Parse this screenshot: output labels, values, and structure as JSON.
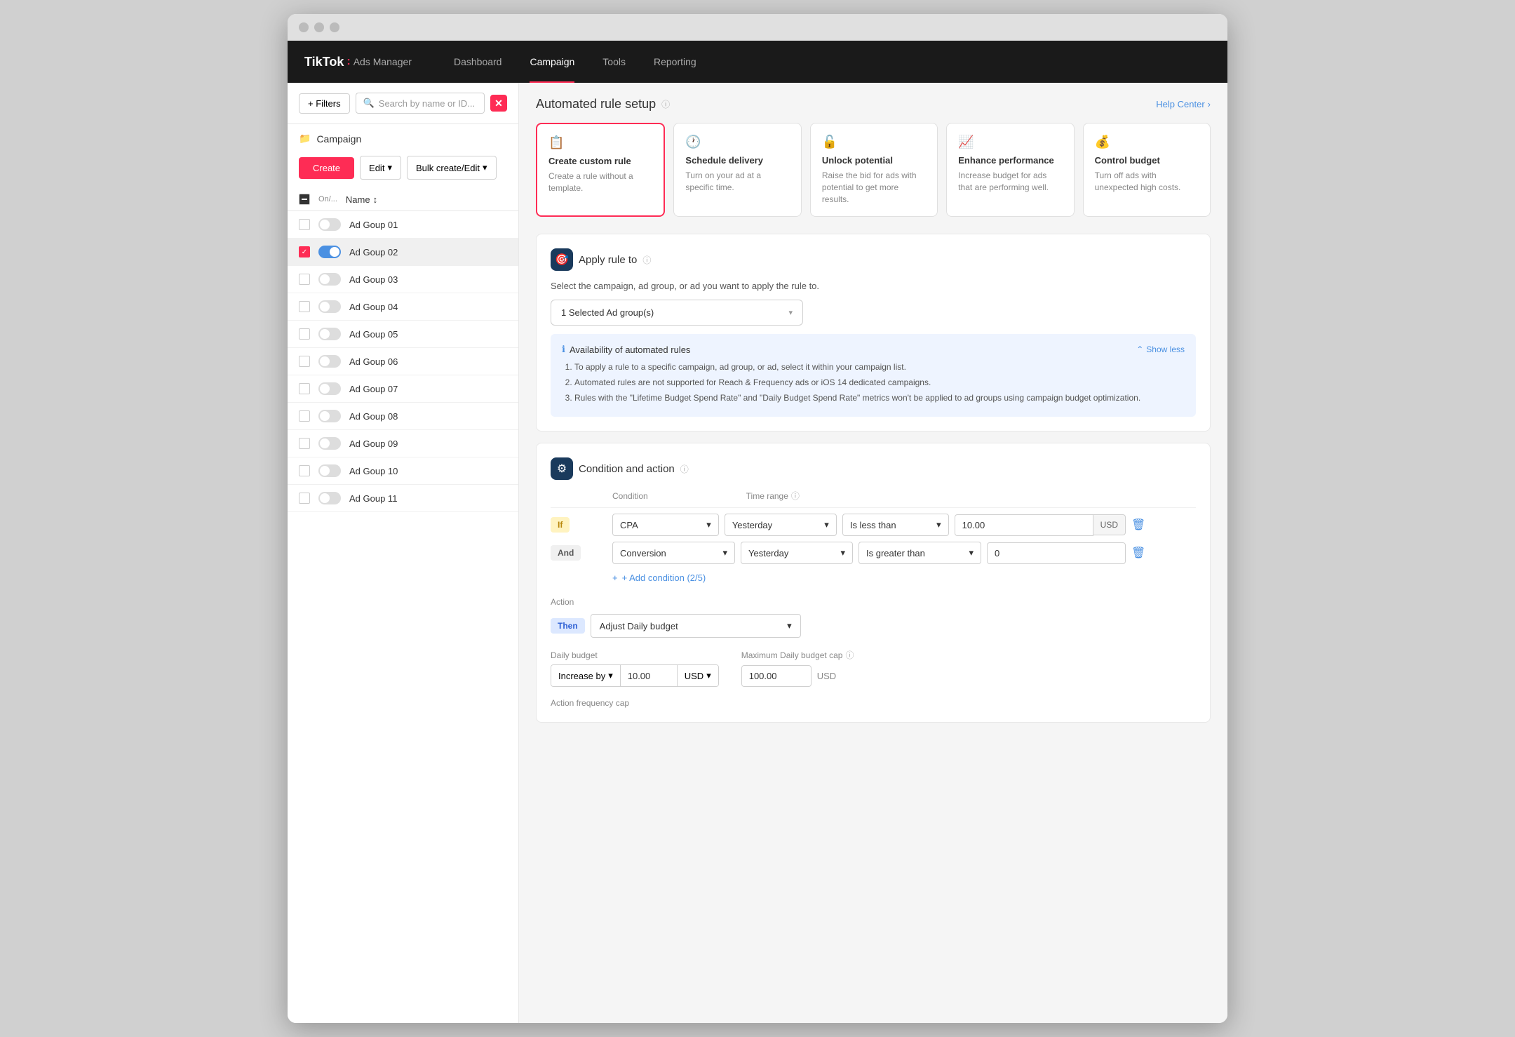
{
  "browser": {
    "dots": [
      "dot1",
      "dot2",
      "dot3"
    ]
  },
  "nav": {
    "brand": "TikTok",
    "colon": ":",
    "sub": "Ads Manager",
    "items": [
      {
        "label": "Dashboard",
        "active": false
      },
      {
        "label": "Campaign",
        "active": true
      },
      {
        "label": "Tools",
        "active": false
      },
      {
        "label": "Reporting",
        "active": false
      }
    ]
  },
  "sidebar": {
    "filters_label": "+ Filters",
    "search_placeholder": "Search by name or ID...",
    "close_x": "✕",
    "section_icon": "📁",
    "section_title": "Campaign",
    "create_label": "Create",
    "edit_label": "Edit",
    "bulk_label": "Bulk create/Edit",
    "table_header_name": "Name",
    "rows": [
      {
        "name": "Ad Goup 01",
        "on": false,
        "checked": false,
        "active": false
      },
      {
        "name": "Ad Goup 02",
        "on": true,
        "checked": true,
        "active": true
      },
      {
        "name": "Ad Goup 03",
        "on": false,
        "checked": false,
        "active": false
      },
      {
        "name": "Ad Goup 04",
        "on": false,
        "checked": false,
        "active": false
      },
      {
        "name": "Ad Goup 05",
        "on": false,
        "checked": false,
        "active": false
      },
      {
        "name": "Ad Goup 06",
        "on": false,
        "checked": false,
        "active": false
      },
      {
        "name": "Ad Goup 07",
        "on": false,
        "checked": false,
        "active": false
      },
      {
        "name": "Ad Goup 08",
        "on": false,
        "checked": false,
        "active": false
      },
      {
        "name": "Ad Goup 09",
        "on": false,
        "checked": false,
        "active": false
      },
      {
        "name": "Ad Goup 10",
        "on": false,
        "checked": false,
        "active": false
      },
      {
        "name": "Ad Goup 11",
        "on": false,
        "checked": false,
        "active": false
      }
    ]
  },
  "content": {
    "page_title": "Automated rule setup",
    "help_center": "Help Center",
    "templates": [
      {
        "id": "create_custom",
        "icon": "📋",
        "title": "Create custom rule",
        "desc": "Create a rule without a template.",
        "selected": true
      },
      {
        "id": "schedule_delivery",
        "icon": "🕐",
        "title": "Schedule delivery",
        "desc": "Turn on your ad at a specific time."
      },
      {
        "id": "unlock_potential",
        "icon": "🔓",
        "title": "Unlock potential",
        "desc": "Raise the bid for ads with potential to get more results."
      },
      {
        "id": "enhance_performance",
        "icon": "📈",
        "title": "Enhance performance",
        "desc": "Increase budget for ads that are performing well."
      },
      {
        "id": "control_budget",
        "icon": "💰",
        "title": "Control budget",
        "desc": "Turn off ads with unexpected high costs."
      }
    ],
    "apply_rule": {
      "section_title": "Apply rule to",
      "description": "Select the campaign, ad group, or ad you want to apply the rule to.",
      "dropdown_value": "1 Selected Ad group(s)",
      "info_title": "Availability of automated rules",
      "show_less": "Show less",
      "info_items": [
        "To apply a rule to a specific campaign, ad group, or ad, select it within your campaign list.",
        "Automated rules are not supported for Reach & Frequency ads or iOS 14 dedicated campaigns.",
        "Rules with the \"Lifetime Budget Spend Rate\" and \"Daily Budget Spend Rate\" metrics won't be applied to ad groups using campaign budget optimization."
      ]
    },
    "condition_action": {
      "section_title": "Condition and action",
      "condition_header": "Condition",
      "time_range_header": "Time range",
      "conditions": [
        {
          "badge": "If",
          "badge_type": "if",
          "metric": "CPA",
          "time_range": "Yesterday",
          "operator": "Is less than",
          "value": "10.00",
          "unit": "USD"
        },
        {
          "badge": "And",
          "badge_type": "and",
          "metric": "Conversion",
          "time_range": "Yesterday",
          "operator": "Is greater than",
          "value": "0",
          "unit": ""
        }
      ],
      "add_condition_label": "+ Add condition (2/5)",
      "action": {
        "label": "Action",
        "badge": "Then",
        "dropdown_value": "Adjust Daily budget",
        "daily_budget_label": "Daily budget",
        "max_budget_label": "Maximum Daily budget cap",
        "increase_by_label": "Increase by",
        "increase_value": "10.00",
        "increase_currency": "USD",
        "max_value": "100.00",
        "max_currency": "USD",
        "freq_label": "Action frequency cap"
      }
    }
  }
}
